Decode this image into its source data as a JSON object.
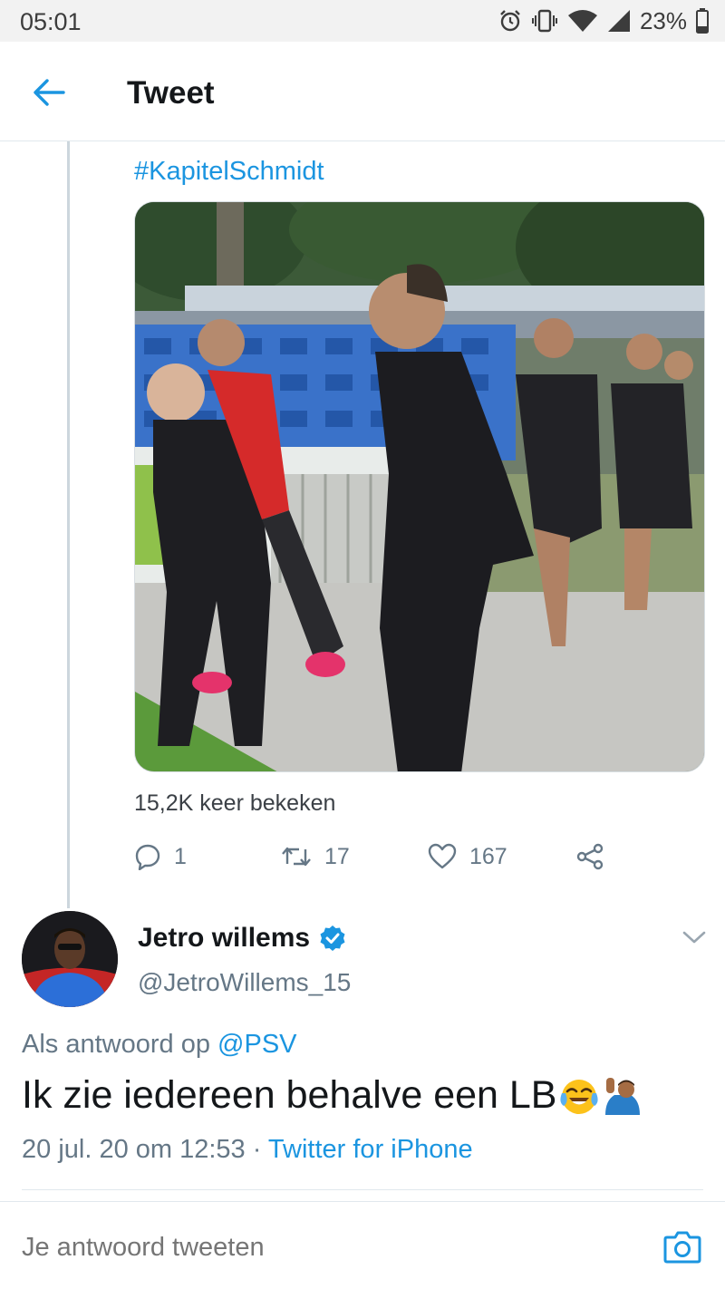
{
  "status_bar": {
    "time": "05:01",
    "battery": "23%",
    "icons": [
      "alarm-icon",
      "vibrate-icon",
      "wifi-icon",
      "signal-icon",
      "battery-icon"
    ]
  },
  "header": {
    "title": "Tweet",
    "back_icon": "arrow-left-icon"
  },
  "quoted_tweet": {
    "hashtag": "#KapitelSchmidt",
    "views": "15,2K keer bekeken",
    "actions": {
      "reply_count": "1",
      "retweet_count": "17",
      "like_count": "167"
    }
  },
  "tweet": {
    "author_name": "Jetro willems",
    "author_handle": "@JetroWillems_15",
    "reply_prefix": "Als antwoord op",
    "reply_mention": "@PSV",
    "text": "Ik zie iedereen behalve een LB",
    "emojis": [
      "face-with-tears-of-joy-emoji",
      "person-raising-hand-emoji"
    ],
    "timestamp": "20 jul. 20 om 12:53 · ",
    "source": "Twitter for iPhone"
  },
  "compose": {
    "placeholder": "Je antwoord tweeten"
  },
  "colors": {
    "accent": "#1b95e0",
    "secondary_text": "#657786",
    "primary_text": "#14171a",
    "divider": "#e1e8ed"
  }
}
